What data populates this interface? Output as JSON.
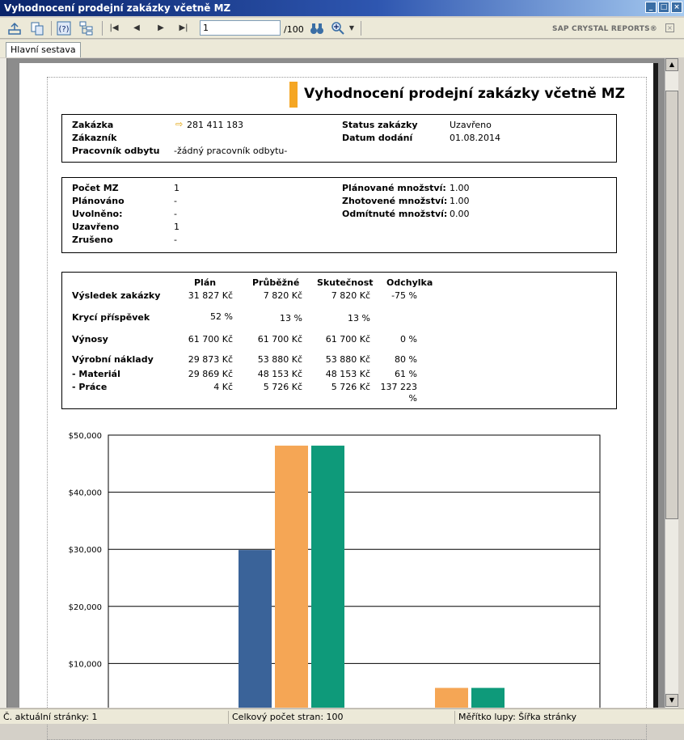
{
  "window": {
    "title": "Vyhodnocení prodejní zakázky včetně MZ"
  },
  "toolbar": {
    "page_value": "1",
    "page_total": "/100",
    "brand": "SAP CRYSTAL REPORTS®"
  },
  "tabs": [
    {
      "label": "Hlavní sestava"
    }
  ],
  "report": {
    "title": "Vyhodnocení prodejní zakázky včetně MZ",
    "order": {
      "zakazka_label": "Zakázka",
      "zakazka_value": "281 411 183",
      "zakaznik_label": "Zákazník",
      "zakaznik_value": "",
      "pracovnik_label": "Pracovník odbytu",
      "pracovnik_value": "-žádný pracovník odbytu-",
      "status_label": "Status zakázky",
      "status_value": "Uzavřeno",
      "datum_label": "Datum dodání",
      "datum_value": "01.08.2014"
    },
    "mz": {
      "pocet_label": "Počet MZ",
      "pocet_value": "1",
      "planovano_label": "Plánováno",
      "planovano_value": "-",
      "uvolneno_label": "Uvolněno:",
      "uvolneno_value": "-",
      "uzavreno_label": "Uzavřeno",
      "uzavreno_value": "1",
      "zruseno_label": "Zrušeno",
      "zruseno_value": "-",
      "plan_mnozstvi_label": "Plánované množství:",
      "plan_mnozstvi_value": "1.00",
      "zhot_mnozstvi_label": "Zhotovené množství:",
      "zhot_mnozstvi_value": "1.00",
      "odm_mnozstvi_label": "Odmítnuté množství:",
      "odm_mnozstvi_value": "0.00"
    },
    "results": {
      "headers": [
        "Plán",
        "Průběžné",
        "Skutečnost",
        "Odchylka"
      ],
      "rows": [
        {
          "label": "Výsledek zakázky",
          "plan": "31 827 Kč",
          "prubezne": "7 820 Kč",
          "skutecnost": "7 820 Kč",
          "odchylka": "-75 %"
        },
        {
          "label": "Krycí příspěvek",
          "plan": "52 %",
          "prubezne": "13 %",
          "skutecnost": "13 %",
          "odchylka": ""
        },
        {
          "label": "Výnosy",
          "plan": "61 700 Kč",
          "prubezne": "61 700 Kč",
          "skutecnost": "61 700 Kč",
          "odchylka": "0 %"
        },
        {
          "label": "Výrobní náklady",
          "plan": "29 873 Kč",
          "prubezne": "53 880 Kč",
          "skutecnost": "53 880 Kč",
          "odchylka": "80 %"
        },
        {
          "label": "- Materiál",
          "plan": "29 869 Kč",
          "prubezne": "48 153 Kč",
          "skutecnost": "48 153 Kč",
          "odchylka": "61 %"
        },
        {
          "label": "- Práce",
          "plan": "4 Kč",
          "prubezne": "5 726 Kč",
          "skutecnost": "5 726 Kč",
          "odchylka": "137 223",
          "odchylka2": "%"
        }
      ]
    }
  },
  "chart_data": {
    "type": "bar",
    "title": "",
    "xlabel": "",
    "ylabel": "",
    "ylim": [
      0,
      50000
    ],
    "y_ticks": [
      "$50,000",
      "$40,000",
      "$30,000",
      "$20,000",
      "$10,000"
    ],
    "categories": [
      "",
      ""
    ],
    "series": [
      {
        "color": "#3a6399",
        "values": [
          29869,
          null
        ]
      },
      {
        "color": "#f5a655",
        "values": [
          48153,
          5726
        ]
      },
      {
        "color": "#0e9a7a",
        "values": [
          48153,
          5726
        ]
      }
    ],
    "grid": true
  },
  "status": {
    "current_page": "Č. aktuální stránky: 1",
    "total_pages": "Celkový počet stran: 100",
    "zoom": "Měřítko lupy: Šířka stránky"
  },
  "colors": {
    "title_bar_start": "#0a246a",
    "accent": "#f5a623"
  }
}
